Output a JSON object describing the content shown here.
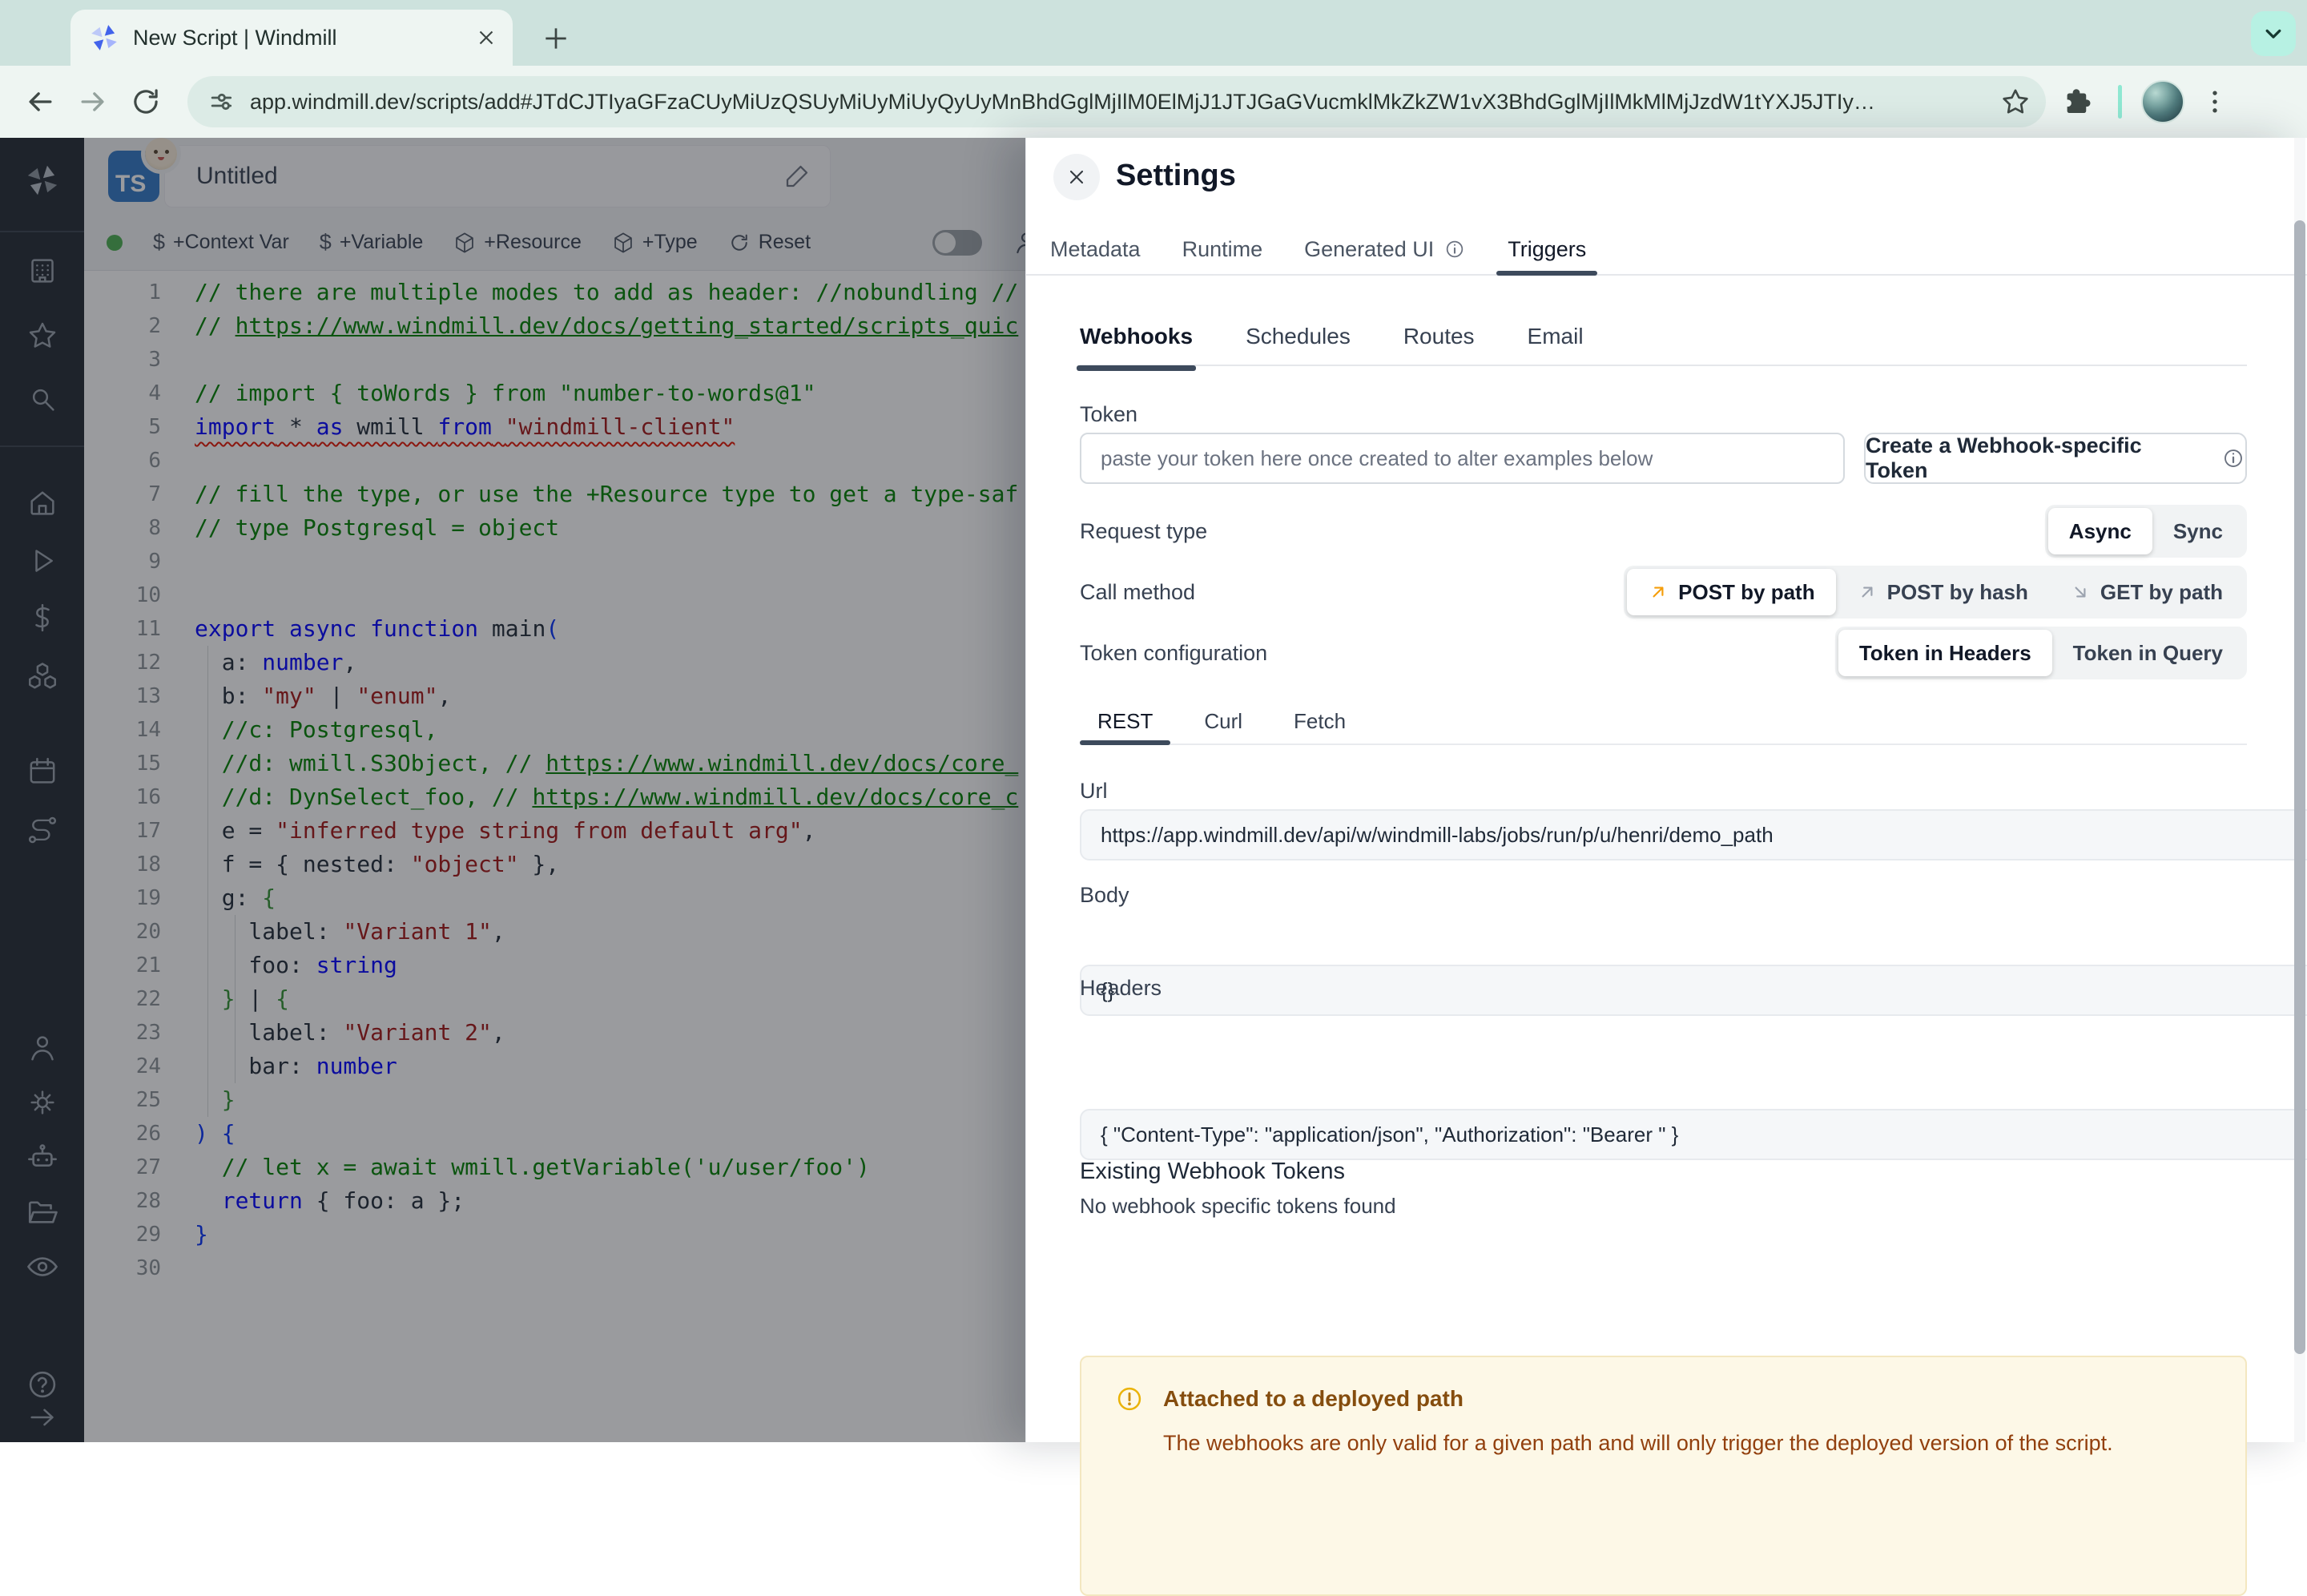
{
  "browser": {
    "tab_title": "New Script | Windmill",
    "url": "app.windmill.dev/scripts/add#JTdCJTIyaGFzaCUyMiUzQSUyMiUyMiUyQyUyMnBhdGglMjIlM0ElMjJ1JTJGaGVucmklMkZkZW1vX3BhdGglMjIlMkMlMjJzdW1tYXJ5JTIy…",
    "icons": [
      "back-arrow",
      "forward-arrow",
      "reload",
      "tune",
      "bookmark-star",
      "extensions-puzzle",
      "profile-avatar",
      "kebab-menu",
      "chevron-down"
    ]
  },
  "sidebar": {
    "icons": [
      "windmill-logo",
      "workspace-building",
      "favorites-star",
      "search",
      "home",
      "runs-play",
      "variables-dollar",
      "resources-cubes",
      "schedules-calendar",
      "routes",
      "user",
      "settings-gear",
      "ai-robot",
      "folders",
      "audit-eye",
      "help-question",
      "expand-arrow"
    ]
  },
  "editor": {
    "language_badge": "TS",
    "title": "Untitled",
    "toolbar": {
      "context_var": "+Context Var",
      "variable": "+Variable",
      "resource": "+Resource",
      "type": "+Type",
      "reset": "Reset"
    },
    "code": {
      "lines": [
        {
          "n": 1,
          "seg": [
            [
              "c",
              "// there are multiple modes to add as header: //nobundling //"
            ]
          ]
        },
        {
          "n": 2,
          "seg": [
            [
              "c",
              "// "
            ],
            [
              "l",
              "https://www.windmill.dev/docs/getting_started/scripts_quic"
            ]
          ]
        },
        {
          "n": 3,
          "seg": []
        },
        {
          "n": 4,
          "seg": [
            [
              "c",
              "// import { toWords } from \"number-to-words@1\""
            ]
          ]
        },
        {
          "n": 5,
          "squiggle": true,
          "seg": [
            [
              "k",
              "import"
            ],
            [
              "d",
              " * "
            ],
            [
              "k",
              "as"
            ],
            [
              "d",
              " wmill "
            ],
            [
              "k",
              "from"
            ],
            [
              "d",
              " "
            ],
            [
              "s",
              "\"windmill-client\""
            ]
          ]
        },
        {
          "n": 6,
          "seg": []
        },
        {
          "n": 7,
          "seg": [
            [
              "c",
              "// fill the type, or use the +Resource type to get a type-saf"
            ]
          ]
        },
        {
          "n": 8,
          "seg": [
            [
              "c",
              "// type Postgresql = object"
            ]
          ]
        },
        {
          "n": 9,
          "seg": []
        },
        {
          "n": 10,
          "seg": []
        },
        {
          "n": 11,
          "seg": [
            [
              "k",
              "export"
            ],
            [
              "d",
              " "
            ],
            [
              "k",
              "async"
            ],
            [
              "d",
              " "
            ],
            [
              "k",
              "function"
            ],
            [
              "d",
              " main"
            ],
            [
              "b",
              "("
            ]
          ]
        },
        {
          "n": 12,
          "seg": [
            [
              "d",
              "  a: "
            ],
            [
              "k",
              "number"
            ],
            [
              "d",
              ","
            ]
          ]
        },
        {
          "n": 13,
          "seg": [
            [
              "d",
              "  b: "
            ],
            [
              "s",
              "\"my\""
            ],
            [
              "d",
              " | "
            ],
            [
              "s",
              "\"enum\""
            ],
            [
              "d",
              ","
            ]
          ]
        },
        {
          "n": 14,
          "seg": [
            [
              "c",
              "  //c: Postgresql,"
            ]
          ]
        },
        {
          "n": 15,
          "seg": [
            [
              "c",
              "  //d: wmill.S3Object, // "
            ],
            [
              "l",
              "https://www.windmill.dev/docs/core_"
            ]
          ]
        },
        {
          "n": 16,
          "seg": [
            [
              "c",
              "  //d: DynSelect_foo, // "
            ],
            [
              "l",
              "https://www.windmill.dev/docs/core_c"
            ]
          ]
        },
        {
          "n": 17,
          "seg": [
            [
              "d",
              "  e = "
            ],
            [
              "s",
              "\"inferred type string from default arg\""
            ],
            [
              "d",
              ","
            ]
          ]
        },
        {
          "n": 18,
          "seg": [
            [
              "d",
              "  f = { nested: "
            ],
            [
              "s",
              "\"object\""
            ],
            [
              "d",
              " },"
            ]
          ]
        },
        {
          "n": 19,
          "seg": [
            [
              "d",
              "  g: "
            ],
            [
              "g",
              "{"
            ]
          ]
        },
        {
          "n": 20,
          "seg": [
            [
              "d",
              "    label: "
            ],
            [
              "s",
              "\"Variant 1\""
            ],
            [
              "d",
              ","
            ]
          ]
        },
        {
          "n": 21,
          "seg": [
            [
              "d",
              "    foo: "
            ],
            [
              "k",
              "string"
            ]
          ]
        },
        {
          "n": 22,
          "seg": [
            [
              "g",
              "  }"
            ],
            [
              "d",
              " | "
            ],
            [
              "g",
              "{"
            ]
          ]
        },
        {
          "n": 23,
          "seg": [
            [
              "d",
              "    label: "
            ],
            [
              "s",
              "\"Variant 2\""
            ],
            [
              "d",
              ","
            ]
          ]
        },
        {
          "n": 24,
          "seg": [
            [
              "d",
              "    bar: "
            ],
            [
              "k",
              "number"
            ]
          ]
        },
        {
          "n": 25,
          "seg": [
            [
              "g",
              "  }"
            ]
          ]
        },
        {
          "n": 26,
          "seg": [
            [
              "b",
              ") {"
            ]
          ]
        },
        {
          "n": 27,
          "seg": [
            [
              "c",
              "  // let x = await wmill.getVariable('u/user/foo')"
            ]
          ]
        },
        {
          "n": 28,
          "seg": [
            [
              "k",
              "  return"
            ],
            [
              "d",
              " { foo: a };"
            ]
          ]
        },
        {
          "n": 29,
          "seg": [
            [
              "b",
              "}"
            ]
          ]
        },
        {
          "n": 30,
          "seg": []
        }
      ]
    }
  },
  "settings": {
    "title": "Settings",
    "tabs": [
      "Metadata",
      "Runtime",
      "Generated UI",
      "Triggers"
    ],
    "active_tab": "Triggers",
    "trigger_tabs": [
      "Webhooks",
      "Schedules",
      "Routes",
      "Email"
    ],
    "active_trigger_tab": "Webhooks",
    "token": {
      "label": "Token",
      "placeholder": "paste your token here once created to alter examples below",
      "create_button": "Create a Webhook-specific Token"
    },
    "request_type": {
      "label": "Request type",
      "options": [
        "Async",
        "Sync"
      ],
      "selected": "Async"
    },
    "call_method": {
      "label": "Call method",
      "options": [
        "POST by path",
        "POST by hash",
        "GET by path"
      ],
      "selected": "POST by path"
    },
    "token_configuration": {
      "label": "Token configuration",
      "options": [
        "Token in Headers",
        "Token in Query"
      ],
      "selected": "Token in Headers"
    },
    "snippet_tabs": [
      "REST",
      "Curl",
      "Fetch"
    ],
    "active_snippet_tab": "REST",
    "fields": {
      "url": {
        "label": "Url",
        "value": "https://app.windmill.dev/api/w/windmill-labs/jobs/run/p/u/henri/demo_path"
      },
      "body": {
        "label": "Body",
        "value": "{}"
      },
      "headers": {
        "label": "Headers",
        "value": "{ \"Content-Type\": \"application/json\", \"Authorization\": \"Bearer \" }"
      }
    },
    "existing_tokens": {
      "title": "Existing Webhook Tokens",
      "empty_message": "No webhook specific tokens found"
    },
    "warning": {
      "title": "Attached to a deployed path",
      "message": "The webhooks are only valid for a given path and will only trigger the deployed version of the script."
    },
    "colors": {
      "selected_method_arrow": "#f59e0b",
      "warning_bg": "#fdf8e7",
      "active_tab_underline": "#3d4a5c"
    }
  }
}
